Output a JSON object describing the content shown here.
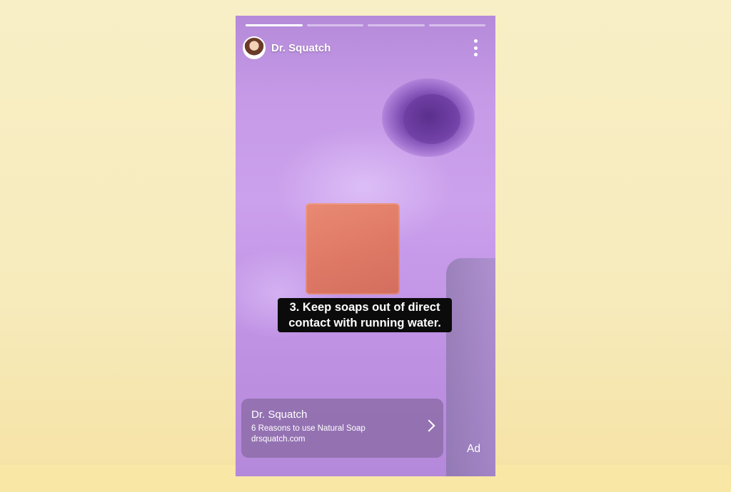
{
  "story": {
    "progress": [
      1,
      0,
      0,
      0
    ],
    "brand_name": "Dr. Squatch",
    "caption_lines": [
      "3. Keep soaps out of direct",
      "contact with running water."
    ],
    "ad_label": "Ad"
  },
  "cta": {
    "title": "Dr. Squatch",
    "subtitle": "6 Reasons to use Natural Soap",
    "url": "drsquatch.com"
  },
  "icons": {
    "more": "more-vertical-icon",
    "chevron": "chevron-right-icon"
  },
  "colors": {
    "background": "#f7ebbc",
    "caption_bg": "#0b0b0b",
    "cta_bg": "#8c6ca8",
    "text": "#ffffff"
  }
}
